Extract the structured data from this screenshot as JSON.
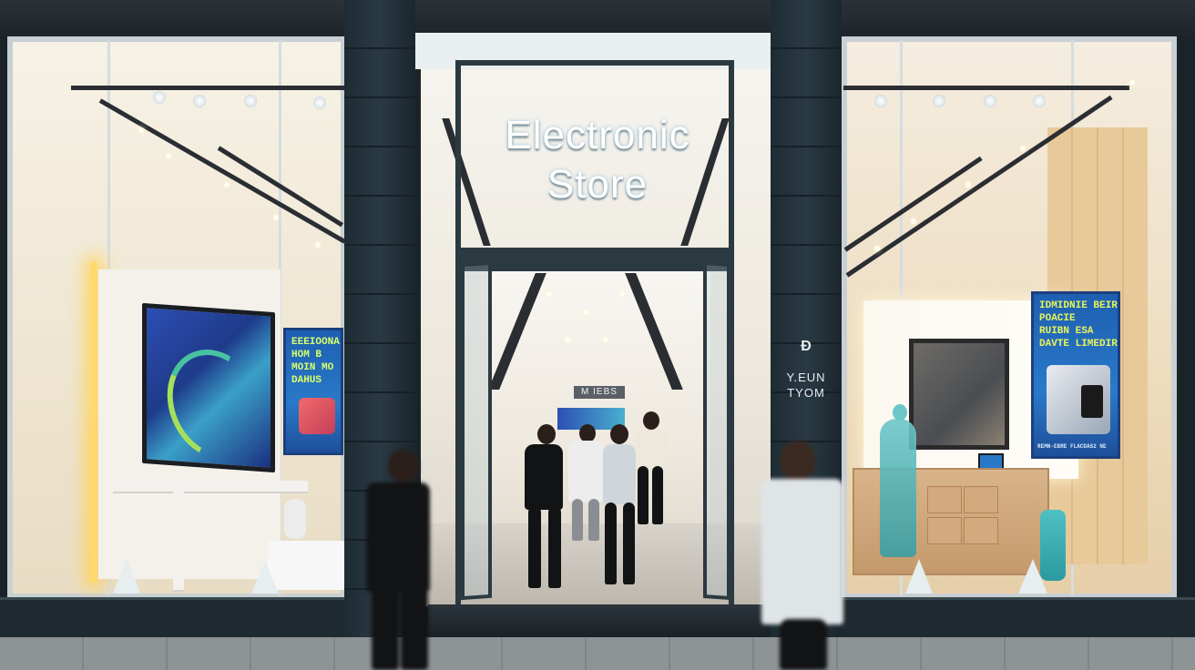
{
  "store": {
    "sign_line1": "Electronic",
    "sign_line2": "Store",
    "pillar_logo": "Ɖ",
    "pillar_line1": "Y.EUN",
    "pillar_line2": "TYOM",
    "interior_sign": "M IEBS"
  },
  "left_poster": {
    "lines": [
      "EEEIOONA",
      "HOM B",
      "MOIN MO",
      "DAHUS"
    ]
  },
  "right_poster": {
    "lines": [
      "IDMIDNIE BEIRE",
      "POACIE",
      "RUIBN  ESA",
      "DAVTE LIMEDIR"
    ],
    "footer": "REMN-EBRE FLACDAS2 NE"
  },
  "colors": {
    "pillar": "#243239",
    "poster_blue": "#1e5fb0",
    "poster_text": "#d9ff6a",
    "accent_glow": "#ffd96a"
  }
}
